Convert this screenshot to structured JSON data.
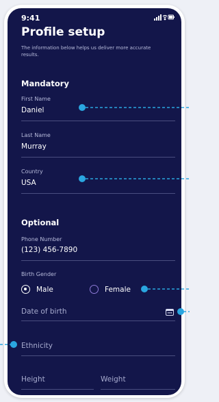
{
  "status_bar": {
    "time": "9:41"
  },
  "header": {
    "title": "Profile setup",
    "subtitle": "The information below helps us deliver more accurate results."
  },
  "sections": {
    "mandatory": "Mandatory",
    "optional": "Optional"
  },
  "fields": {
    "first_name": {
      "label": "First Name",
      "value": "Daniel"
    },
    "last_name": {
      "label": "Last Name",
      "value": "Murray"
    },
    "country": {
      "label": "Country",
      "value": "USA"
    },
    "phone": {
      "label": "Phone Number",
      "value": "(123) 456-7890"
    },
    "birth_gender": {
      "label": "Birth Gender",
      "options": [
        "Male",
        "Female"
      ],
      "selected": "Male"
    },
    "date_of_birth": {
      "placeholder": "Date of birth"
    },
    "ethnicity": {
      "placeholder": "Ethnicity"
    },
    "height": {
      "placeholder": "Height"
    },
    "weight": {
      "placeholder": "Weight"
    }
  },
  "colors": {
    "screen_bg": "#13164a",
    "annotation_accent": "#2aa6e0",
    "radio_unselected": "#8f7bd8",
    "frame": "#ffffff"
  }
}
